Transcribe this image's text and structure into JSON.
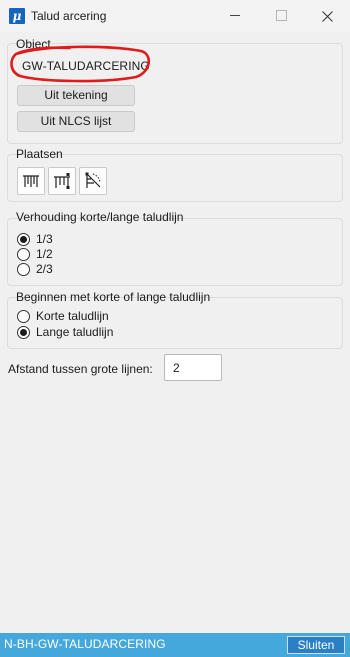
{
  "window": {
    "title": "Talud arcering",
    "app_icon_glyph": "μ"
  },
  "object_group": {
    "legend": "Object",
    "value": "GW-TALUDARCERING",
    "from_drawing_button": "Uit tekening",
    "from_nlcs_button": "Uit NLCS lijst"
  },
  "place_group": {
    "legend": "Plaatsen",
    "tools": [
      {
        "icon": "place-between-lines-icon"
      },
      {
        "icon": "place-between-points-icon"
      },
      {
        "icon": "place-radial-icon"
      }
    ]
  },
  "ratio_group": {
    "legend": "Verhouding korte/lange taludlijn",
    "options": [
      "1/3",
      "1/2",
      "2/3"
    ],
    "selected": "1/3"
  },
  "start_group": {
    "legend": "Beginnen met korte of lange taludlijn",
    "options": [
      "Korte taludlijn",
      "Lange taludlijn"
    ],
    "selected": "Lange taludlijn"
  },
  "spacing": {
    "label": "Afstand tussen grote lijnen:",
    "value": "2"
  },
  "status_bar": {
    "text": "N-BH-GW-TALUDARCERING",
    "close_button": "Sluiten"
  },
  "colors": {
    "app_icon": "#1565c0",
    "status_bar": "#45a8dc",
    "close_button": "#2b7fc3",
    "annotation_circle": "#e11b1b"
  }
}
